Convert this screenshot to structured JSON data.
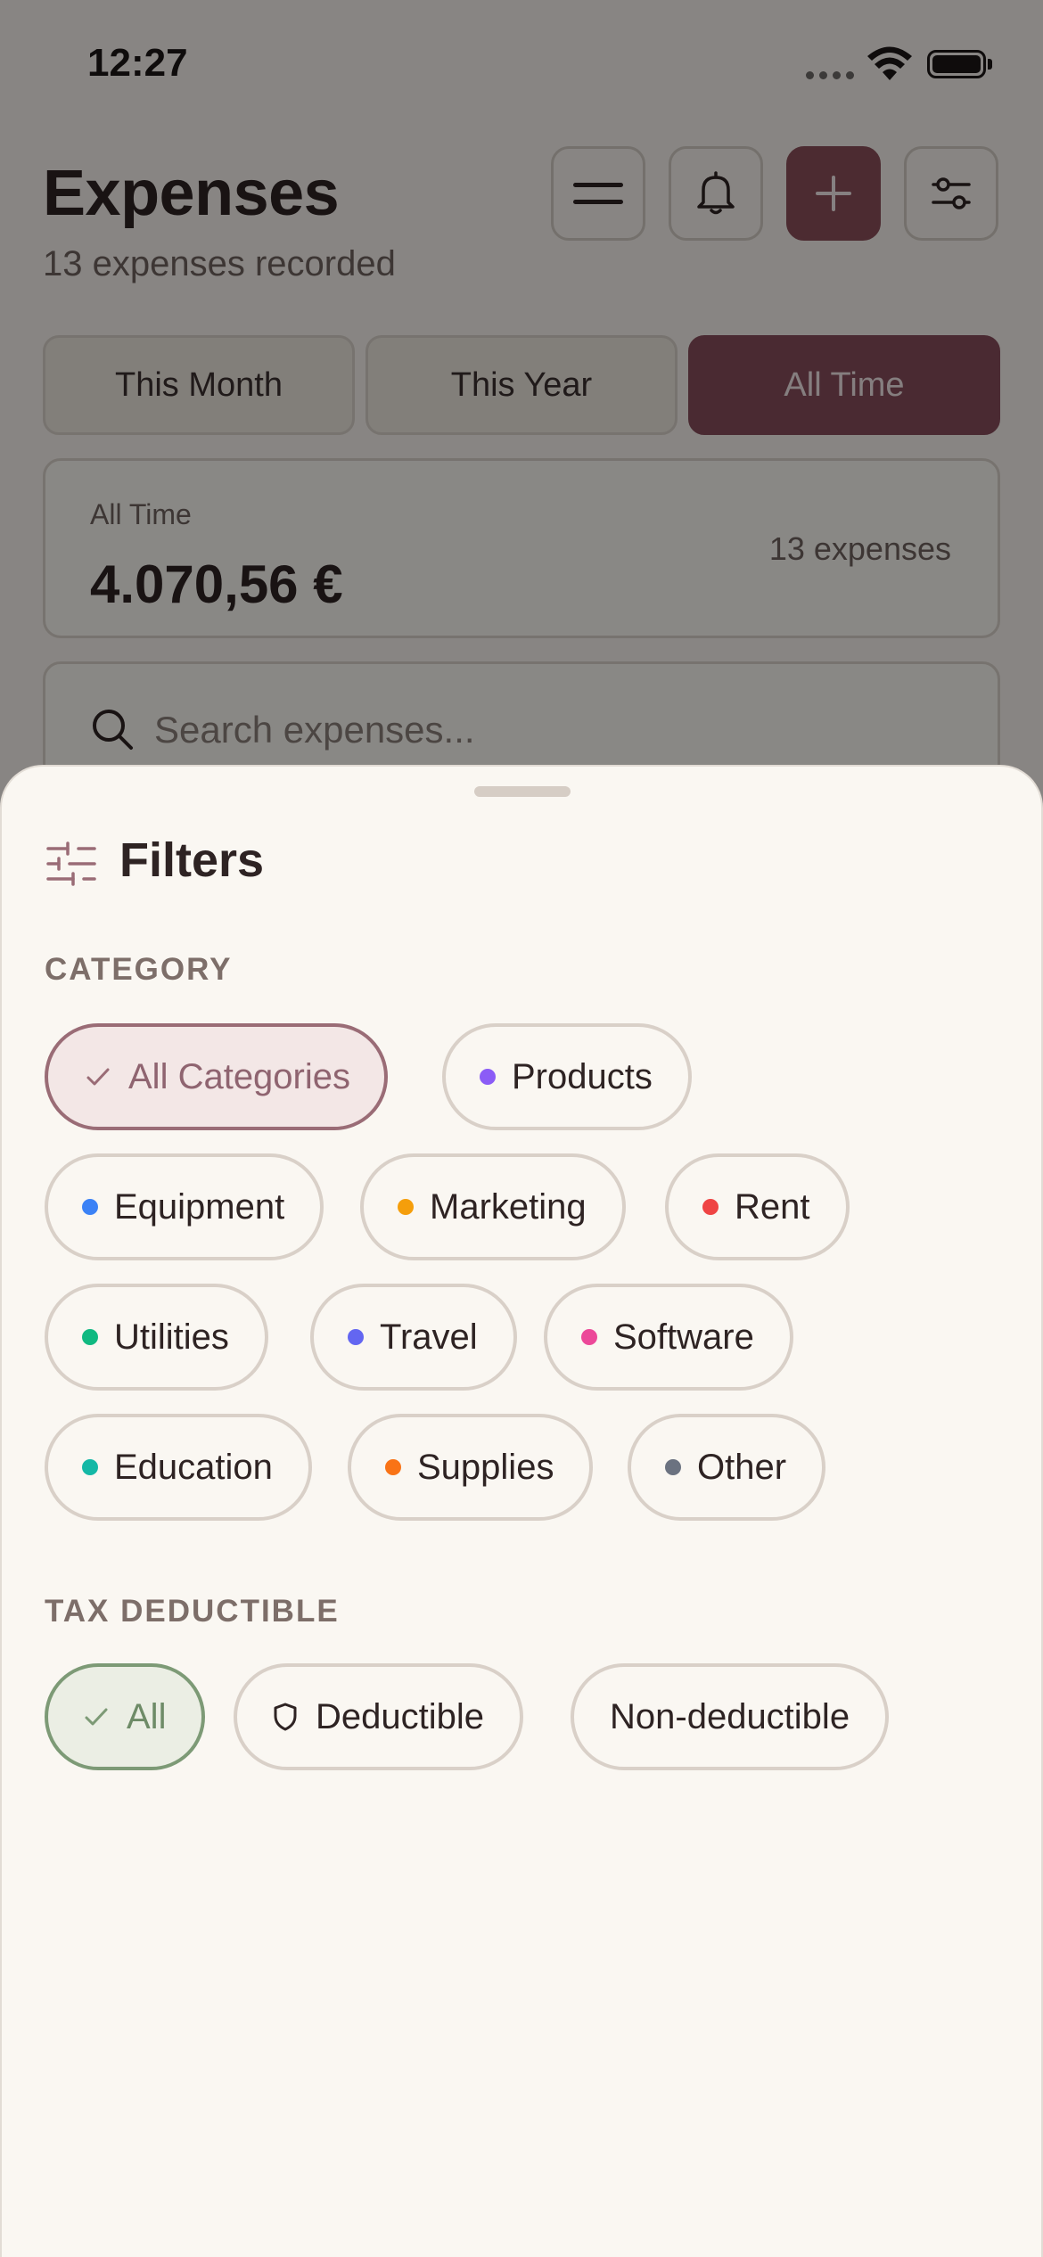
{
  "status_bar": {
    "time": "12:27"
  },
  "header": {
    "title": "Expenses",
    "subtitle": "13 expenses recorded",
    "buttons": [
      {
        "name": "menu",
        "icon": "menu-icon"
      },
      {
        "name": "notifications",
        "icon": "bell-icon"
      },
      {
        "name": "add",
        "icon": "plus-icon"
      },
      {
        "name": "filter",
        "icon": "sliders-icon"
      }
    ]
  },
  "period_tabs": [
    "This Month",
    "This Year",
    "All Time"
  ],
  "active_period": "All Time",
  "summary": {
    "label": "All Time",
    "amount": "4.070,56 €",
    "count": "13 expenses"
  },
  "search": {
    "placeholder": "Search expenses..."
  },
  "sheet": {
    "title": "Filters",
    "category_label": "CATEGORY",
    "categories": [
      {
        "label": "All Categories",
        "selected": true
      },
      {
        "label": "Products",
        "color": "#8b5cf6"
      },
      {
        "label": "Equipment",
        "color": "#3b82f6"
      },
      {
        "label": "Marketing",
        "color": "#f59e0b"
      },
      {
        "label": "Rent",
        "color": "#ef4444"
      },
      {
        "label": "Utilities",
        "color": "#10b981"
      },
      {
        "label": "Travel",
        "color": "#6366f1"
      },
      {
        "label": "Software",
        "color": "#ec4899"
      },
      {
        "label": "Education",
        "color": "#14b8a6"
      },
      {
        "label": "Supplies",
        "color": "#f97316"
      },
      {
        "label": "Other",
        "color": "#6b7280"
      }
    ],
    "tax_label": "TAX DEDUCTIBLE",
    "tax_options": [
      {
        "label": "All",
        "selected": true
      },
      {
        "label": "Deductible",
        "icon": "shield-icon"
      },
      {
        "label": "Non-deductible"
      }
    ]
  },
  "colors": {
    "accent": "#874e5b",
    "background": "#f7f3ee",
    "selected_category": "#9a6c76",
    "selected_tax": "#7d9a76"
  }
}
